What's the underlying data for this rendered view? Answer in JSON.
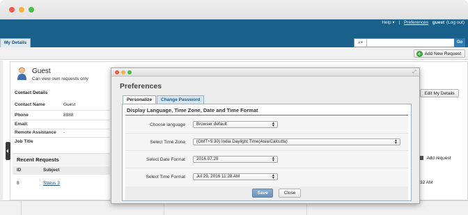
{
  "header": {
    "help_label": "Help ▾",
    "separator": "|",
    "preferences_link": "Preferences",
    "user_name": "guest",
    "logout_label": "(Log out)",
    "tab_label": "My Details",
    "search_dropdown_icon": "magnifier-dropdown-icon",
    "go_label": "Go"
  },
  "toolbar": {
    "add_request_label": "Add New Request"
  },
  "profile": {
    "name": "Guest",
    "subtitle": "Can view own requests only",
    "edit_button": "Edit My Details"
  },
  "contact": {
    "section_title": "Contact Details",
    "rows": [
      {
        "label": "Contact Name",
        "value": "Guest"
      },
      {
        "label": "Phone",
        "value": "8888"
      },
      {
        "label": "Email:",
        "value": ""
      },
      {
        "label": "Remote Assistance",
        "value": "-"
      },
      {
        "label": "Job Title",
        "value": ""
      }
    ]
  },
  "recent_requests": {
    "title": "Recent Requests",
    "columns": [
      "ID",
      "Subject"
    ],
    "rows": [
      {
        "id": "8",
        "subject": "Status 3"
      }
    ],
    "add_request_label": "Add request",
    "time_fragment": "32 AM"
  },
  "modal": {
    "title": "Preferences",
    "tabs": [
      {
        "label": "Personalize",
        "active": true
      },
      {
        "label": "Change Password",
        "active": false
      }
    ],
    "section_heading": "Display Language, Time Zone, Date and Time Format",
    "fields": [
      {
        "label": "Choose language",
        "value": "Browser default"
      },
      {
        "label": "Select Time Zone",
        "value": "(GMT+5:30) India Daylight Time(Asia/Calcutta)"
      },
      {
        "label": "Select Date Format",
        "value": "2016.07.29"
      },
      {
        "label": "Select Time Format",
        "value": "Jul 29, 2016 11:28 AM"
      }
    ],
    "save_label": "Save",
    "close_label": "Close"
  },
  "colors": {
    "header_bg": "#19608a",
    "accent_blue": "#3e7aa6",
    "save_button": "#6a92bb"
  }
}
